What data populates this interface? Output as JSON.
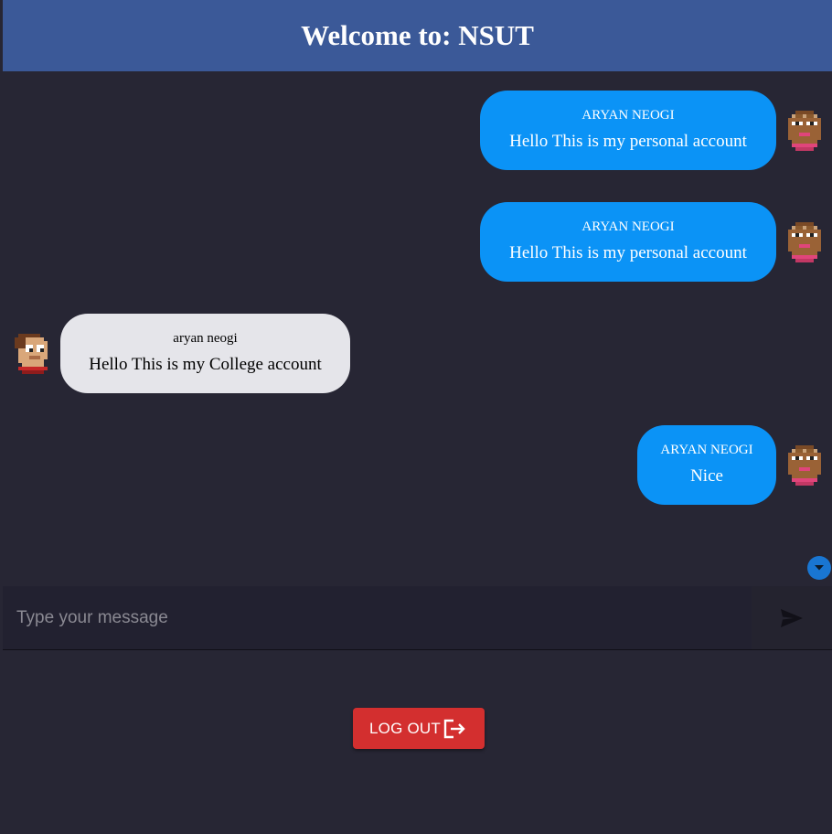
{
  "header": {
    "title": "Welcome to: NSUT"
  },
  "messages": [
    {
      "sender": "ARYAN NEOGI",
      "text": "Hello This is my personal account",
      "side": "sent"
    },
    {
      "sender": "ARYAN NEOGI",
      "text": "Hello This is my personal account",
      "side": "sent"
    },
    {
      "sender": "aryan neogi",
      "text": "Hello This is my College account",
      "side": "received"
    },
    {
      "sender": "ARYAN NEOGI",
      "text": "Nice",
      "side": "sent"
    }
  ],
  "composer": {
    "placeholder": "Type your message",
    "value": ""
  },
  "logout": {
    "label": "LOG OUT"
  },
  "colors": {
    "header_bg": "#3b5998",
    "page_bg": "#272634",
    "sent_bubble": "#0b93f6",
    "received_bubble": "#e5e5ea",
    "logout_bg": "#d32f2f",
    "scroll_button": "#1976d2"
  },
  "icons": {
    "send": "send-icon",
    "scroll": "chevron-down-icon",
    "logout": "logout-icon",
    "avatar": "pixel-avatar"
  }
}
